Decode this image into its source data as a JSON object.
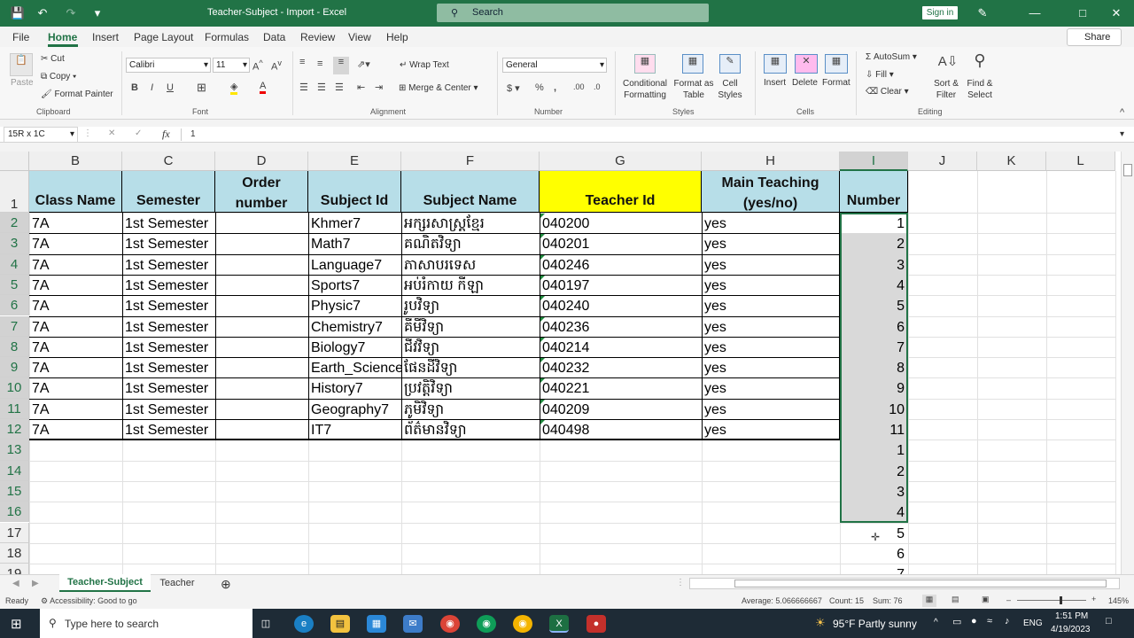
{
  "titlebar": {
    "title": "Teacher-Subject - Import - Excel",
    "search_placeholder": "Search",
    "signin": "Sign in",
    "color": "#217346"
  },
  "menu": [
    "File",
    "Home",
    "Insert",
    "Page Layout",
    "Formulas",
    "Data",
    "Review",
    "View",
    "Help"
  ],
  "share": "Share",
  "ribbon": {
    "clipboard": {
      "paste": "Paste",
      "cut": "Cut",
      "copy": "Copy",
      "format_painter": "Format Painter",
      "label": "Clipboard"
    },
    "font": {
      "name": "Calibri",
      "size": "11",
      "label": "Font"
    },
    "alignment": {
      "wrap": "Wrap Text",
      "merge": "Merge & Center",
      "label": "Alignment"
    },
    "number": {
      "format": "General",
      "label": "Number"
    },
    "styles": {
      "conditional": "Conditional Formatting",
      "format_table": "Format as Table",
      "cell_styles": "Cell Styles",
      "label": "Styles"
    },
    "cells": {
      "insert": "Insert",
      "delete": "Delete",
      "format": "Format",
      "label": "Cells"
    },
    "editing": {
      "autosum": "AutoSum",
      "fill": "Fill",
      "clear": "Clear",
      "sort": "Sort & Filter",
      "find": "Find & Select",
      "label": "Editing"
    }
  },
  "formula_bar": {
    "name_box": "15R x 1C",
    "fx": "fx",
    "value": "1"
  },
  "columns": [
    "B",
    "C",
    "D",
    "E",
    "F",
    "G",
    "H",
    "I",
    "J",
    "K",
    "L"
  ],
  "rows": [
    "1",
    "2",
    "3",
    "4",
    "5",
    "6",
    "7",
    "8",
    "9",
    "10",
    "11",
    "12",
    "13",
    "14",
    "15",
    "16",
    "17",
    "18",
    "19"
  ],
  "headers": {
    "class": "Class Name",
    "semester": "Semester",
    "order_l1": "Order",
    "order_l2": "number",
    "subject_id": "Subject Id",
    "subject_name": "Subject Name",
    "teacher_id": "Teacher Id",
    "main_l1": "Main Teaching",
    "main_l2": "(yes/no)",
    "number": "Number"
  },
  "data_rows": [
    {
      "class": "7A",
      "semester": "1st Semester",
      "subject_id": "Khmer7",
      "subject_name": "អក្សរសាស្ត្រខ្មែរ",
      "teacher_id": "040200",
      "main": "yes"
    },
    {
      "class": "7A",
      "semester": "1st Semester",
      "subject_id": "Math7",
      "subject_name": "គណិតវិទ្យា",
      "teacher_id": "040201",
      "main": "yes"
    },
    {
      "class": "7A",
      "semester": "1st Semester",
      "subject_id": "Language7",
      "subject_name": "ភាសាបរទេស",
      "teacher_id": "040246",
      "main": "yes"
    },
    {
      "class": "7A",
      "semester": "1st Semester",
      "subject_id": "Sports7",
      "subject_name": "អប់រំកាយ កីឡា",
      "teacher_id": "040197",
      "main": "yes"
    },
    {
      "class": "7A",
      "semester": "1st Semester",
      "subject_id": "Physic7",
      "subject_name": "រូបវិទ្យា",
      "teacher_id": "040240",
      "main": "yes"
    },
    {
      "class": "7A",
      "semester": "1st Semester",
      "subject_id": "Chemistry7",
      "subject_name": "គីមីវិទ្យា",
      "teacher_id": "040236",
      "main": "yes"
    },
    {
      "class": "7A",
      "semester": "1st Semester",
      "subject_id": "Biology7",
      "subject_name": "ជីវវិទ្យា",
      "teacher_id": "040214",
      "main": "yes"
    },
    {
      "class": "7A",
      "semester": "1st Semester",
      "subject_id": "Earth_Science",
      "subject_name": "ផែនដីវិទ្យា",
      "teacher_id": "040232",
      "main": "yes"
    },
    {
      "class": "7A",
      "semester": "1st Semester",
      "subject_id": "History7",
      "subject_name": "ប្រវត្តិវិទ្យា",
      "teacher_id": "040221",
      "main": "yes"
    },
    {
      "class": "7A",
      "semester": "1st Semester",
      "subject_id": "Geography7",
      "subject_name": "ភូមិវិទ្យា",
      "teacher_id": "040209",
      "main": "yes"
    },
    {
      "class": "7A",
      "semester": "1st Semester",
      "subject_id": "IT7",
      "subject_name": "ព័ត៌មានវិទ្យា",
      "teacher_id": "040498",
      "main": "yes"
    }
  ],
  "number_col": [
    "1",
    "2",
    "3",
    "4",
    "5",
    "6",
    "7",
    "8",
    "9",
    "10",
    "11",
    "1",
    "2",
    "3",
    "4",
    "5",
    "6",
    "7"
  ],
  "sheets": [
    "Teacher-Subject",
    "Teacher"
  ],
  "status": {
    "ready": "Ready",
    "accessibility": "Accessibility: Good to go",
    "average": "Average: 5.066666667",
    "count": "Count: 15",
    "sum": "Sum: 76",
    "zoom": "145%"
  },
  "taskbar": {
    "search": "Type here to search",
    "weather": "95°F  Partly sunny",
    "lang": "ENG",
    "time": "1:51 PM",
    "date": "4/19/2023"
  }
}
